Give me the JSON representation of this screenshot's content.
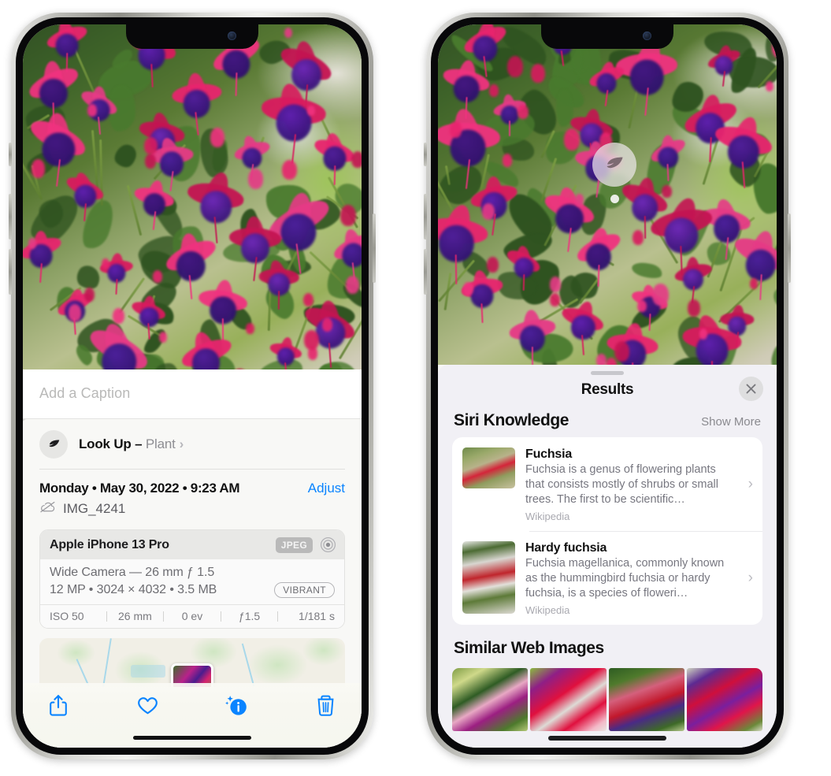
{
  "left_phone": {
    "photo_label": "fuchsia-flowers-photo",
    "caption": {
      "placeholder": "Add a Caption",
      "value": ""
    },
    "look_up": {
      "label": "Look Up",
      "dash": " – ",
      "subject": "Plant",
      "chevron": "›",
      "icon": "leaf-icon"
    },
    "info": {
      "datetime": "Monday • May 30, 2022 • 9:23 AM",
      "adjust_label": "Adjust",
      "filename": "IMG_4241",
      "cloud_icon": "icloud-slash-icon"
    },
    "camera": {
      "model": "Apple iPhone 13 Pro",
      "format_badge": "JPEG",
      "aperture_icon": "aperture-icon",
      "lens_line": "Wide Camera — 26 mm ƒ 1.5",
      "specs_line": "12 MP • 3024 × 4032 • 3.5 MB",
      "style_badge": "VIBRANT",
      "exif": [
        "ISO 50",
        "26 mm",
        "0 ev",
        "ƒ1.5",
        "1/181 s"
      ]
    },
    "map": {
      "label": "photo-location-map"
    },
    "toolbar": [
      {
        "name": "share-button",
        "icon": "share-icon"
      },
      {
        "name": "favorite-button",
        "icon": "heart-icon"
      },
      {
        "name": "info-button",
        "icon": "info-sparkle-icon"
      },
      {
        "name": "delete-button",
        "icon": "trash-icon"
      }
    ]
  },
  "right_phone": {
    "photo_label": "fuchsia-flowers-photo",
    "visual_lookup_badge": {
      "icon": "leaf-icon"
    },
    "sheet": {
      "title": "Results",
      "close_label": "✕",
      "sections": [
        {
          "title": "Siri Knowledge",
          "action_label": "Show More",
          "items": [
            {
              "title": "Fuchsia",
              "description": "Fuchsia is a genus of flowering plants that consists mostly of shrubs or small trees. The first to be scientific…",
              "source": "Wikipedia",
              "chevron": "›"
            },
            {
              "title": "Hardy fuchsia",
              "description": "Fuchsia magellanica, commonly known as the hummingbird fuchsia or hardy fuchsia, is a species of floweri…",
              "source": "Wikipedia",
              "chevron": "›"
            }
          ]
        },
        {
          "title": "Similar Web Images",
          "thumbnails": [
            "fuchsia-web-image-1",
            "fuchsia-web-image-2",
            "fuchsia-web-image-3",
            "fuchsia-web-image-4"
          ]
        }
      ]
    }
  },
  "colors": {
    "accent_blue": "#0a84ff",
    "sheet_bg": "#f1f0f5",
    "card_bg": "#ffffff",
    "secondary_text": "#8e8e93"
  }
}
